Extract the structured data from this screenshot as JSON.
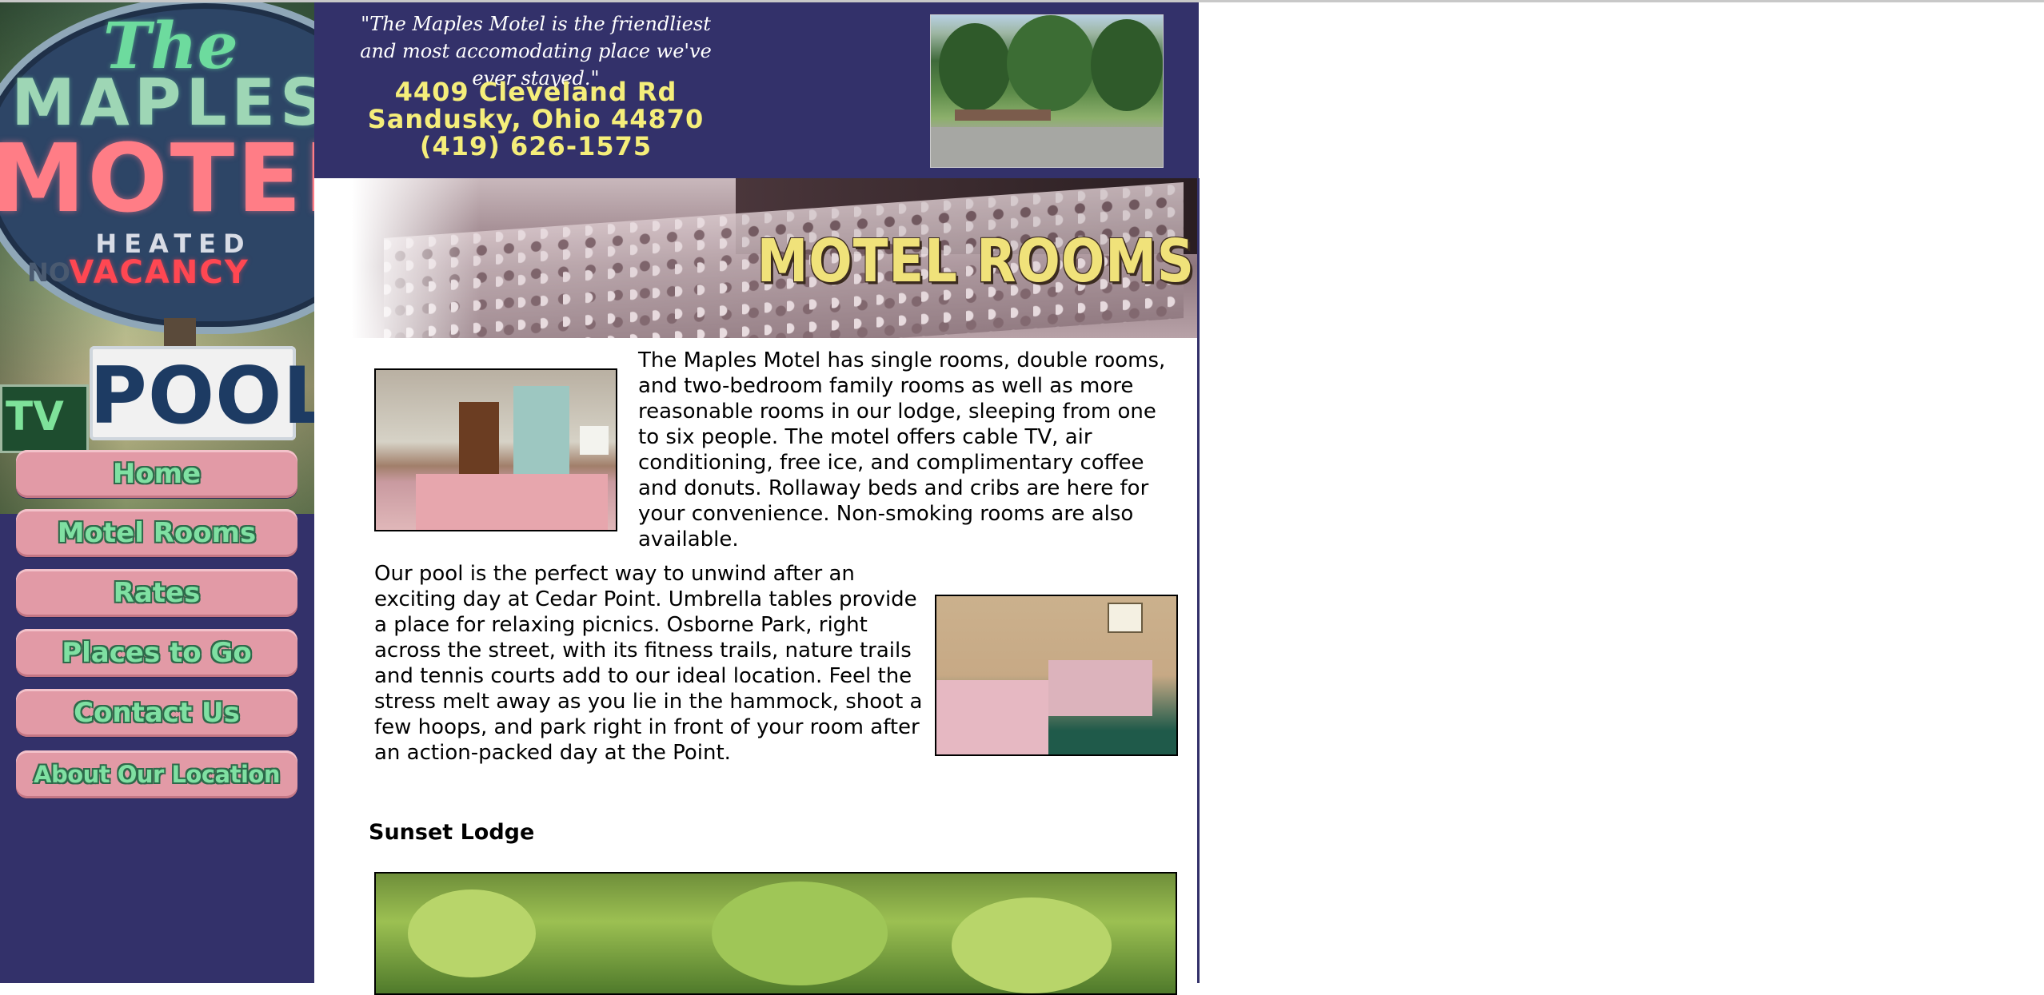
{
  "logo": {
    "line1": "The",
    "line2": "MAPLES",
    "line3": "MOTEL",
    "heated": "HEATED",
    "no": "NO",
    "vacancy": "VACANCY",
    "pool": "POOL",
    "tv": "TV"
  },
  "nav": {
    "items": [
      {
        "label": "Home"
      },
      {
        "label": "Motel Rooms"
      },
      {
        "label": "Rates"
      },
      {
        "label": "Places to Go"
      },
      {
        "label": "Contact Us"
      },
      {
        "label": "About Our Location"
      }
    ]
  },
  "header": {
    "quote": "\"The Maples Motel is the friendliest and most accomodating place we've ever stayed.\"",
    "address_line1": "4409 Cleveland Rd",
    "address_line2": "Sandusky, Ohio 44870",
    "phone": "(419) 626-1575"
  },
  "banner": {
    "title": "MOTEL ROOMS"
  },
  "main": {
    "paragraph1": "The Maples Motel has single rooms, double rooms, and two-bedroom family rooms as well as more reasonable rooms in our lodge, sleeping from one to six people. The motel offers cable TV, air conditioning, free ice, and complimentary coffee and donuts. Rollaway beds and cribs are here for your convenience. Non-smoking rooms are also available.",
    "paragraph2": "Our pool is the perfect way to unwind after an exciting day at Cedar Point. Umbrella tables provide a place for relaxing picnics. Osborne Park, right across the street, with its fitness trails, nature trails and tennis courts add to our ideal location. Feel the stress melt away as you lie in the hammock, shoot a few hoops, and park right in front of your room after an action-packed day at the Point.",
    "section_heading": "Sunset Lodge"
  },
  "colors": {
    "sidebar_bg": "#33316a",
    "nav_button": "#e29aa6",
    "nav_text": "#7fe0a2",
    "address_text": "#f5ee7a",
    "banner_title": "#f0e27a"
  }
}
